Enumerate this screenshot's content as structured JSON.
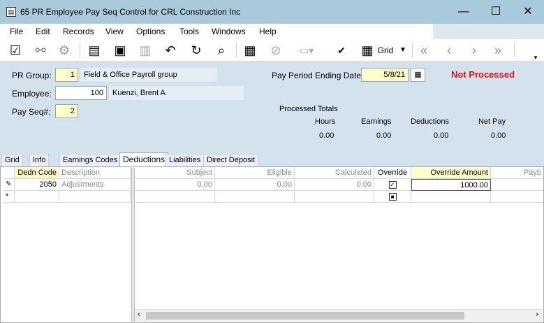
{
  "window": {
    "title": "65 PR Employee Pay Seq Control for CRL Construction Inc",
    "controls": {
      "minimize": "—",
      "maximize": "☐",
      "close": "✕"
    }
  },
  "menu": [
    "File",
    "Edit",
    "Records",
    "View",
    "Options",
    "Tools",
    "Windows",
    "Help"
  ],
  "toolbar": {
    "grid_label": "Grid",
    "icons": [
      "edit-icon",
      "find-icon",
      "settings-gear-icon",
      "new-document-icon",
      "save-icon",
      "delete-trash-icon",
      "undo-icon",
      "refresh-icon",
      "search-icon",
      "grid-layout-icon",
      "attach-icon",
      "print-icon",
      "spellcheck-icon",
      "grid-table-icon",
      "first-record-icon",
      "previous-record-icon",
      "next-record-icon",
      "last-record-icon"
    ]
  },
  "form": {
    "pr_group_label": "PR Group:",
    "pr_group_value": "1",
    "pr_group_desc": "Field & Office Payroll group",
    "employee_label": "Employee:",
    "employee_value": "100",
    "employee_name": "Kuenzi, Brent A",
    "pay_seq_label": "Pay Seq#:",
    "pay_seq_value": "2",
    "pay_period_label": "Pay Period Ending Date:",
    "pay_period_value": "5/8/21",
    "status": "Not Processed",
    "status_color": "#e01010"
  },
  "totals": {
    "title": "Processed Totals",
    "headers": [
      "Hours",
      "Earnings",
      "Deductions",
      "Net Pay"
    ],
    "values": [
      "0.00",
      "0.00",
      "0.00",
      "0.00"
    ]
  },
  "tabs": [
    "Grid",
    "Info",
    "Earnings Codes",
    "Deductions",
    "Liabilities",
    "Direct Deposit"
  ],
  "active_tab": "Deductions",
  "grid": {
    "headers": {
      "dedn_code": "Dedn Code",
      "description": "Description",
      "subject": "Subject",
      "eligible": "Eligible",
      "calculated": "Calculated",
      "override": "Override",
      "override_amount": "Override Amount",
      "payback": "Payb"
    },
    "row": {
      "indicator": "✎",
      "dedn_code": "2050",
      "description": "Adjustments",
      "subject": "0.00",
      "eligible": "0.00",
      "calculated": "0.00",
      "override_checked": true,
      "override_amount": "1000.00"
    },
    "new_row_indicator": "*"
  },
  "colors": {
    "titlebar": "#a9c9dc",
    "form_bg": "#d3e2ec",
    "required_field": "#ffffcc"
  }
}
